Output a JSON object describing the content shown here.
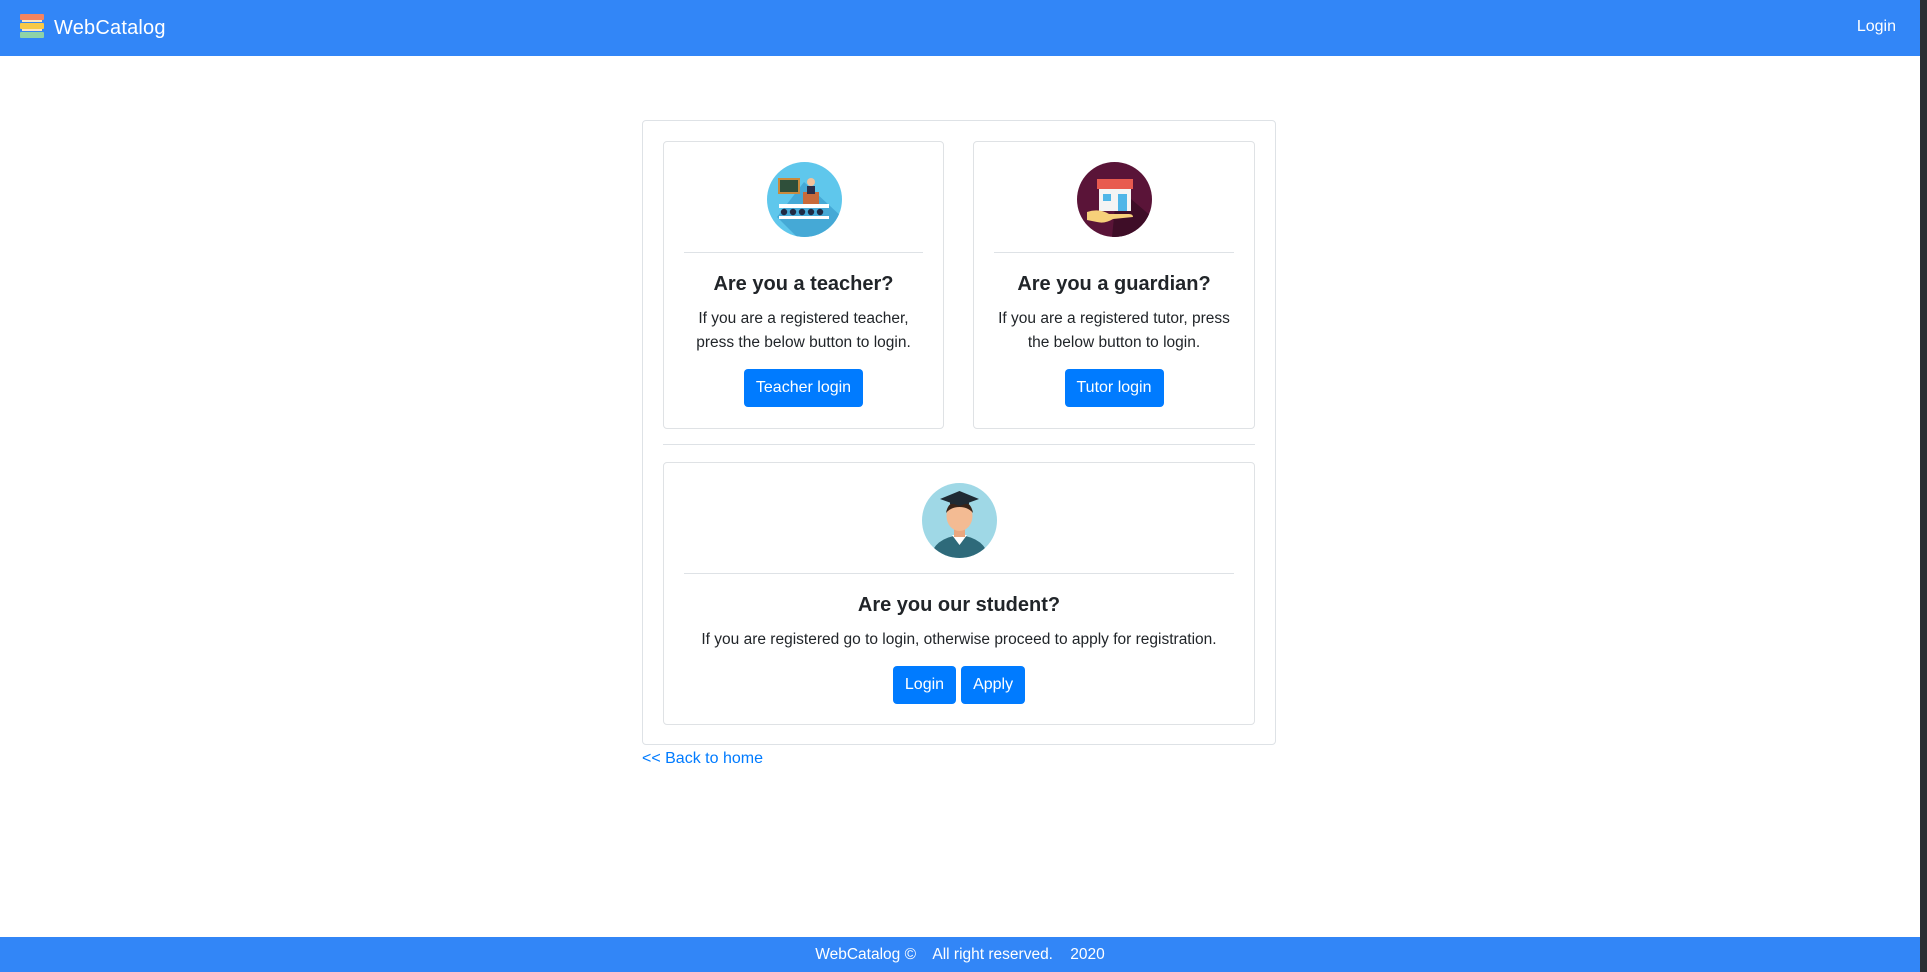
{
  "header": {
    "brand": "WebCatalog",
    "login_label": "Login"
  },
  "teacher_card": {
    "icon": "teacher-classroom-icon",
    "title": "Are you a teacher?",
    "text": "If you are a registered teacher, press the below button to login.",
    "button_label": "Teacher login"
  },
  "guardian_card": {
    "icon": "home-in-hand-icon",
    "title": "Are you a guardian?",
    "text": "If you are a registered tutor, press the below button to login.",
    "button_label": "Tutor login"
  },
  "student_card": {
    "icon": "graduate-student-icon",
    "title": "Are you our student?",
    "text": "If you are registered go to login, otherwise proceed to apply for registration.",
    "login_label": "Login",
    "apply_label": "Apply"
  },
  "back_link": "<< Back to home",
  "footer": {
    "brand": "WebCatalog ©",
    "rights": "All right reserved.",
    "year": "2020"
  },
  "colors": {
    "navbar": "#3286f7",
    "button": "#007bff"
  }
}
